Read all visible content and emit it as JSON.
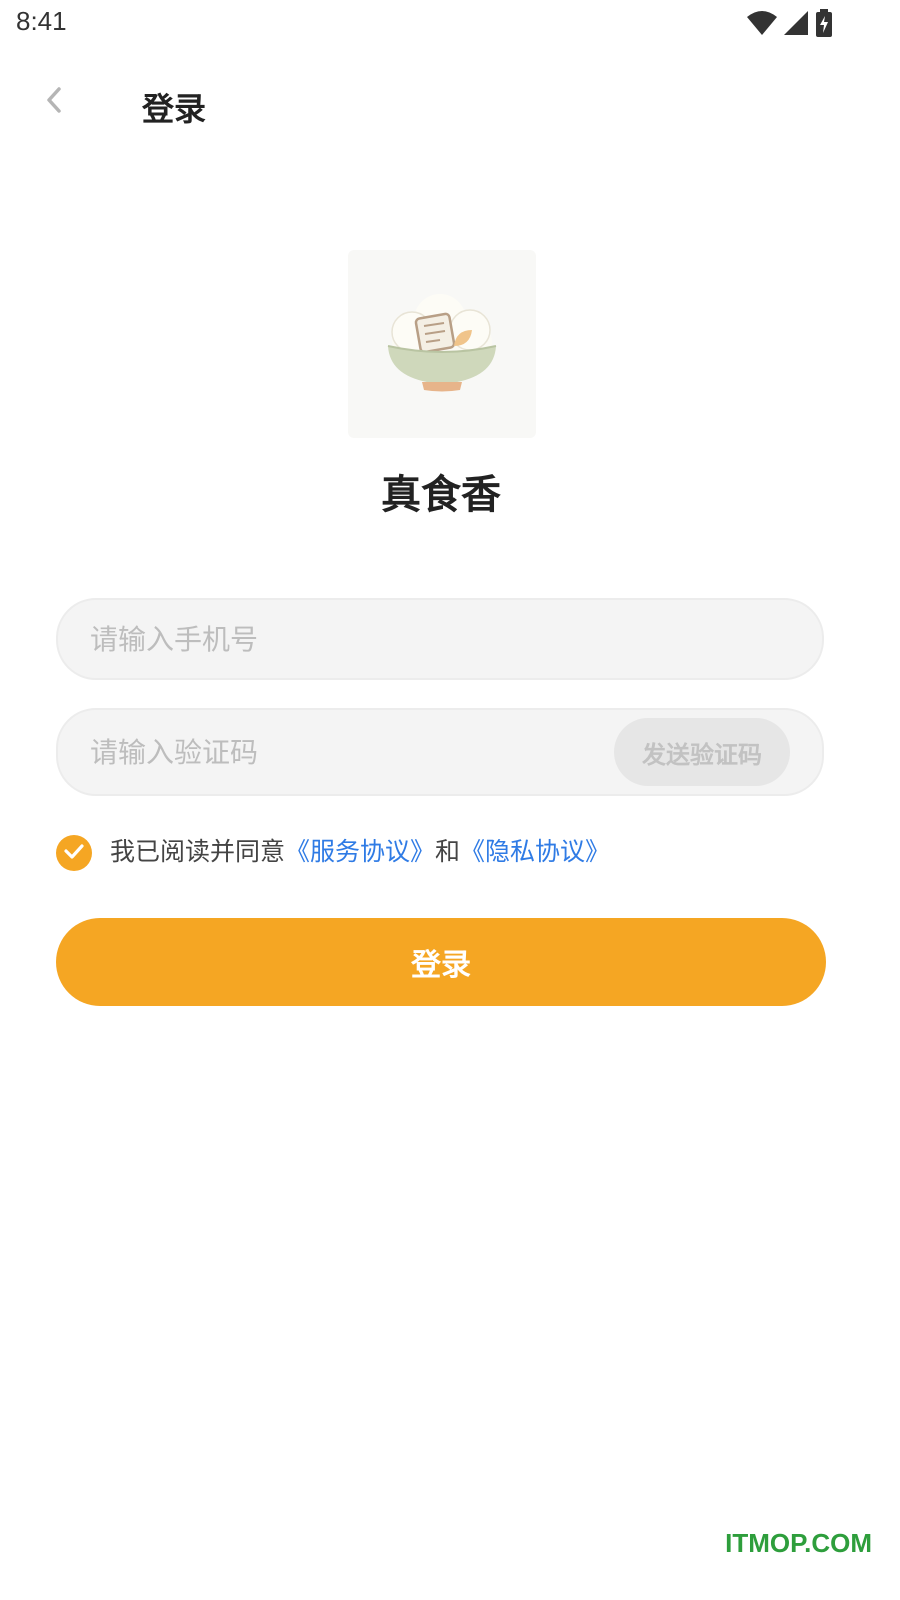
{
  "status_bar": {
    "time": "8:41",
    "icons": [
      "wifi-icon",
      "cellular-signal-icon",
      "battery-charging-icon"
    ]
  },
  "header": {
    "title": "登录",
    "back_icon": "chevron-left-icon"
  },
  "logo": {
    "icon": "rice-bowl-recipe-logo"
  },
  "app_name": "真食香",
  "form": {
    "phone": {
      "value": "",
      "placeholder": "请输入手机号"
    },
    "code": {
      "value": "",
      "placeholder": "请输入验证码"
    },
    "send_code_label": "发送验证码"
  },
  "agreement": {
    "checked": true,
    "prefix": "我已阅读并同意",
    "service_link": "《服务协议》",
    "joiner": "和",
    "privacy_link": "《隐私协议》"
  },
  "login_button_label": "登录",
  "watermark": "ITMOP.COM",
  "colors": {
    "accent": "#f5a623",
    "link": "#2f7be5",
    "input_bg": "#f4f4f4",
    "placeholder": "#bdbdbd",
    "watermark": "#2e9e3c"
  }
}
